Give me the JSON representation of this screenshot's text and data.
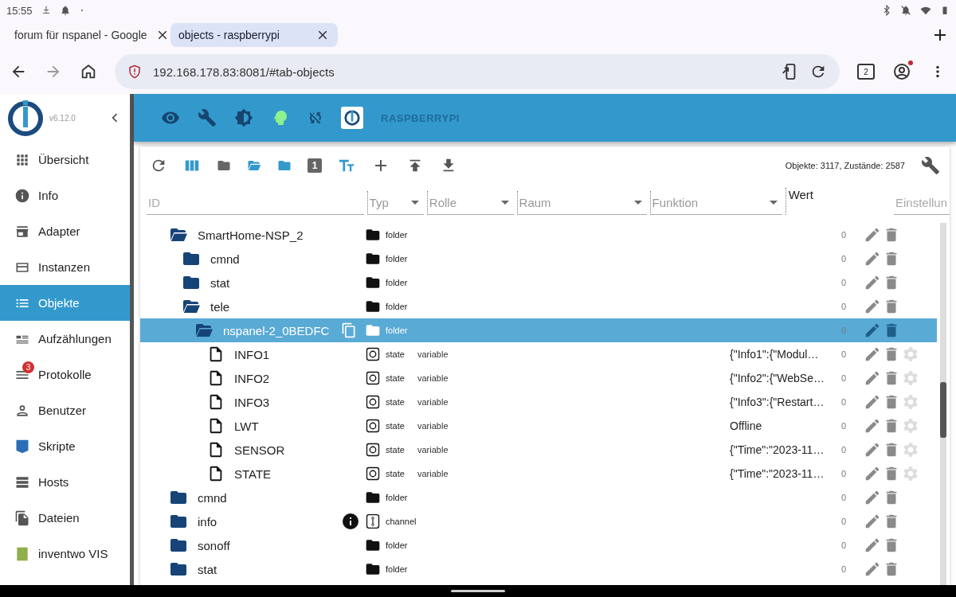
{
  "status_bar": {
    "time": "15:55"
  },
  "browser": {
    "tabs": [
      {
        "title": "forum für nspanel - Google",
        "selected": false
      },
      {
        "title": "objects - raspberrypi",
        "selected": true
      }
    ],
    "url": "192.168.178.83:8081/#tab-objects",
    "tab_count": "2"
  },
  "sidebar": {
    "version": "v6.12.0",
    "items": [
      {
        "label": "Übersicht",
        "selected": false
      },
      {
        "label": "Info",
        "selected": false
      },
      {
        "label": "Adapter",
        "selected": false
      },
      {
        "label": "Instanzen",
        "selected": false
      },
      {
        "label": "Objekte",
        "selected": true
      },
      {
        "label": "Aufzählungen",
        "selected": false
      },
      {
        "label": "Protokolle",
        "selected": false,
        "badge": "3"
      },
      {
        "label": "Benutzer",
        "selected": false
      },
      {
        "label": "Skripte",
        "selected": false
      },
      {
        "label": "Hosts",
        "selected": false
      },
      {
        "label": "Dateien",
        "selected": false
      },
      {
        "label": "inventwo VIS",
        "selected": false
      }
    ]
  },
  "header": {
    "title": "RASPBERRYPI"
  },
  "toolbar": {
    "depth_number": "1",
    "stats": "Objekte: 3117, Zustände: 2587"
  },
  "filters": [
    {
      "kind": "text",
      "placeholder": "ID"
    },
    {
      "kind": "select",
      "placeholder": "Typ"
    },
    {
      "kind": "select",
      "placeholder": "Rolle"
    },
    {
      "kind": "select",
      "placeholder": "Raum"
    },
    {
      "kind": "select",
      "placeholder": "Funktion"
    },
    {
      "kind": "label",
      "label": "Wert"
    },
    {
      "kind": "text",
      "placeholder": "Einstellun"
    }
  ],
  "tree": [
    {
      "name": "SmartHome-NSP_2",
      "kind": "folder",
      "expanded": true,
      "selected": false,
      "type": "folder",
      "count": "0",
      "children": [
        {
          "name": "cmnd",
          "kind": "folder",
          "expanded": false,
          "selected": false,
          "type": "folder",
          "count": "0"
        },
        {
          "name": "stat",
          "kind": "folder",
          "expanded": false,
          "selected": false,
          "type": "folder",
          "count": "0"
        },
        {
          "name": "tele",
          "kind": "folder",
          "expanded": true,
          "selected": false,
          "type": "folder",
          "count": "0",
          "children": [
            {
              "name": "nspanel-2_0BEDFC",
              "kind": "folder",
              "expanded": true,
              "selected": true,
              "type": "folder",
              "count": "0",
              "children": [
                {
                  "name": "INFO1",
                  "kind": "state",
                  "selected": false,
                  "type": "state",
                  "role": "variable",
                  "value": "{\"Info1\":{\"Modul…",
                  "count": "0"
                },
                {
                  "name": "INFO2",
                  "kind": "state",
                  "selected": false,
                  "type": "state",
                  "role": "variable",
                  "value": "{\"Info2\":{\"WebSe…",
                  "count": "0"
                },
                {
                  "name": "INFO3",
                  "kind": "state",
                  "selected": false,
                  "type": "state",
                  "role": "variable",
                  "value": "{\"Info3\":{\"Restart…",
                  "count": "0"
                },
                {
                  "name": "LWT",
                  "kind": "state",
                  "selected": false,
                  "type": "state",
                  "role": "variable",
                  "value": "Offline",
                  "count": "0"
                },
                {
                  "name": "SENSOR",
                  "kind": "state",
                  "selected": false,
                  "type": "state",
                  "role": "variable",
                  "value": "{\"Time\":\"2023-11…",
                  "count": "0"
                },
                {
                  "name": "STATE",
                  "kind": "state",
                  "selected": false,
                  "type": "state",
                  "role": "variable",
                  "value": "{\"Time\":\"2023-11…",
                  "count": "0"
                }
              ]
            }
          ]
        }
      ]
    },
    {
      "name": "cmnd",
      "kind": "folder",
      "expanded": false,
      "selected": false,
      "type": "folder",
      "count": "0"
    },
    {
      "name": "info",
      "kind": "channel",
      "expanded": false,
      "selected": false,
      "has_info": true,
      "type": "channel",
      "count": "0"
    },
    {
      "name": "sonoff",
      "kind": "folder",
      "expanded": false,
      "selected": false,
      "type": "folder",
      "count": "0"
    },
    {
      "name": "stat",
      "kind": "folder",
      "expanded": false,
      "selected": false,
      "type": "folder",
      "count": "0"
    }
  ]
}
